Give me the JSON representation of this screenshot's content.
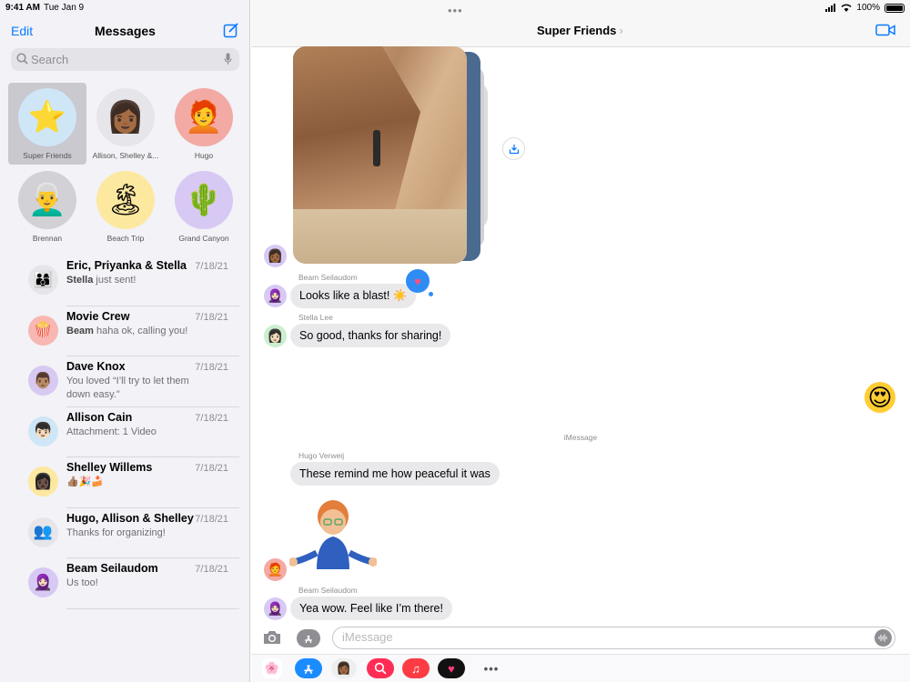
{
  "status": {
    "time": "9:41 AM",
    "date": "Tue Jan 9",
    "battery": "100%"
  },
  "sidebar": {
    "edit": "Edit",
    "title": "Messages",
    "search_placeholder": "Search",
    "pinned": [
      {
        "label": "Super Friends",
        "emoji": "⭐",
        "bg": "#cfe6f7",
        "selected": true
      },
      {
        "label": "Allison, Shelley &...",
        "emoji": "👩🏾",
        "bg": "#e5e5ea"
      },
      {
        "label": "Hugo",
        "emoji": "🧑‍🦰",
        "bg": "#f3a9a4"
      },
      {
        "label": "Brennan",
        "emoji": "👨‍🦳",
        "bg": "#d1d1d6"
      },
      {
        "label": "Beach Trip",
        "emoji": "🏝",
        "bg": "#fde8a0"
      },
      {
        "label": "Grand Canyon",
        "emoji": "🌵",
        "bg": "#d7c9f4"
      }
    ],
    "conversations": [
      {
        "name": "Eric, Priyanka & Stella",
        "date": "7/18/21",
        "sender": "Stella",
        "preview": " just sent!",
        "emoji": "👨‍👩‍👦",
        "bg": "#e5e5ea"
      },
      {
        "name": "Movie Crew",
        "date": "7/18/21",
        "sender": "Beam",
        "preview": " haha ok, calling you!",
        "emoji": "🍿",
        "bg": "#f8b7b2"
      },
      {
        "name": "Dave Knox",
        "date": "7/18/21",
        "sender": "",
        "preview": "You loved “I’ll try to let them down easy.”",
        "emoji": "👨🏽",
        "bg": "#d8c9f2"
      },
      {
        "name": "Allison Cain",
        "date": "7/18/21",
        "sender": "",
        "preview": "Attachment: 1 Video",
        "emoji": "👦🏻",
        "bg": "#cfe6f7"
      },
      {
        "name": "Shelley Willems",
        "date": "7/18/21",
        "sender": "",
        "preview": "👍🏽🎉🍰",
        "emoji": "👩🏿",
        "bg": "#fde8a0"
      },
      {
        "name": "Hugo, Allison & Shelley",
        "date": "7/18/21",
        "sender": "",
        "preview": "Thanks for organizing!",
        "emoji": "👥",
        "bg": "#e5e5ea"
      },
      {
        "name": "Beam Seilaudom",
        "date": "7/18/21",
        "sender": "",
        "preview": "Us too!",
        "emoji": "🧕🏻",
        "bg": "#d7c9f4"
      }
    ]
  },
  "chat": {
    "title": "Super Friends",
    "imessage_label": "iMessage",
    "composer_placeholder": "iMessage",
    "messages": [
      {
        "sender": "Beam Seilaudom",
        "text": "Looks like a blast! ☀️"
      },
      {
        "sender": "Stella Lee",
        "text": "So good, thanks for sharing!"
      },
      {
        "sender": "Hugo Verweij",
        "text": "These remind me how peaceful it was"
      },
      {
        "sender": "Beam Seilaudom",
        "text": "Yea wow.  Feel like I’m there!"
      }
    ],
    "reaction_emoji": "😍",
    "tapback_icon": "heart"
  },
  "app_drawer": [
    "photos",
    "app-store",
    "memoji",
    "search-images",
    "music",
    "digital-touch",
    "more"
  ]
}
